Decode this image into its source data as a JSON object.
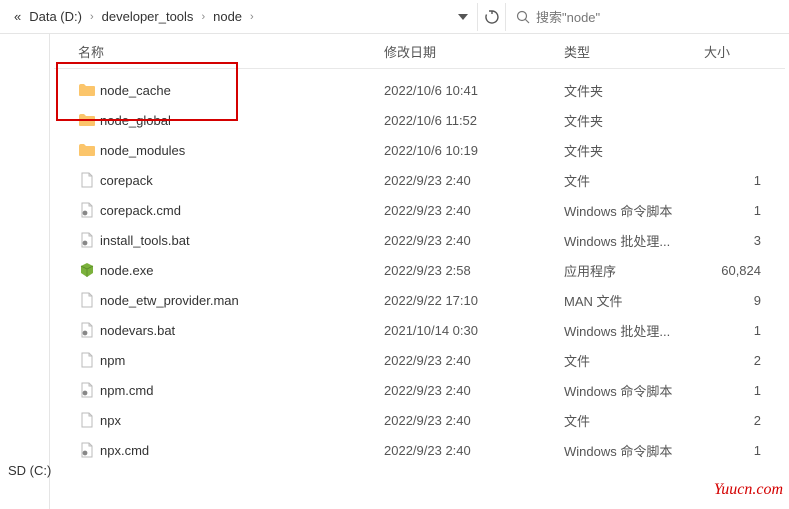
{
  "toolbar": {
    "breadcrumb": {
      "ellipsis": "«",
      "items": [
        "Data (D:)",
        "developer_tools",
        "node"
      ]
    },
    "search_placeholder": "搜索\"node\""
  },
  "sidebar": {
    "items": [
      {
        "label": "SD (C:)"
      }
    ]
  },
  "columns": {
    "name": "名称",
    "date": "修改日期",
    "type": "类型",
    "size": "大小"
  },
  "files": [
    {
      "icon": "folder",
      "name": "node_cache",
      "date": "2022/10/6 10:41",
      "type": "文件夹",
      "size": ""
    },
    {
      "icon": "folder",
      "name": "node_global",
      "date": "2022/10/6 11:52",
      "type": "文件夹",
      "size": ""
    },
    {
      "icon": "folder",
      "name": "node_modules",
      "date": "2022/10/6 10:19",
      "type": "文件夹",
      "size": ""
    },
    {
      "icon": "blank",
      "name": "corepack",
      "date": "2022/9/23 2:40",
      "type": "文件",
      "size": "1"
    },
    {
      "icon": "cmd",
      "name": "corepack.cmd",
      "date": "2022/9/23 2:40",
      "type": "Windows 命令脚本",
      "size": "1"
    },
    {
      "icon": "cmd",
      "name": "install_tools.bat",
      "date": "2022/9/23 2:40",
      "type": "Windows 批处理...",
      "size": "3"
    },
    {
      "icon": "exe",
      "name": "node.exe",
      "date": "2022/9/23 2:58",
      "type": "应用程序",
      "size": "60,824"
    },
    {
      "icon": "blank",
      "name": "node_etw_provider.man",
      "date": "2022/9/22 17:10",
      "type": "MAN 文件",
      "size": "9"
    },
    {
      "icon": "cmd",
      "name": "nodevars.bat",
      "date": "2021/10/14 0:30",
      "type": "Windows 批处理...",
      "size": "1"
    },
    {
      "icon": "blank",
      "name": "npm",
      "date": "2022/9/23 2:40",
      "type": "文件",
      "size": "2"
    },
    {
      "icon": "cmd",
      "name": "npm.cmd",
      "date": "2022/9/23 2:40",
      "type": "Windows 命令脚本",
      "size": "1"
    },
    {
      "icon": "blank",
      "name": "npx",
      "date": "2022/9/23 2:40",
      "type": "文件",
      "size": "2"
    },
    {
      "icon": "cmd",
      "name": "npx.cmd",
      "date": "2022/9/23 2:40",
      "type": "Windows 命令脚本",
      "size": "1"
    }
  ],
  "watermark": "Yuucn.com"
}
